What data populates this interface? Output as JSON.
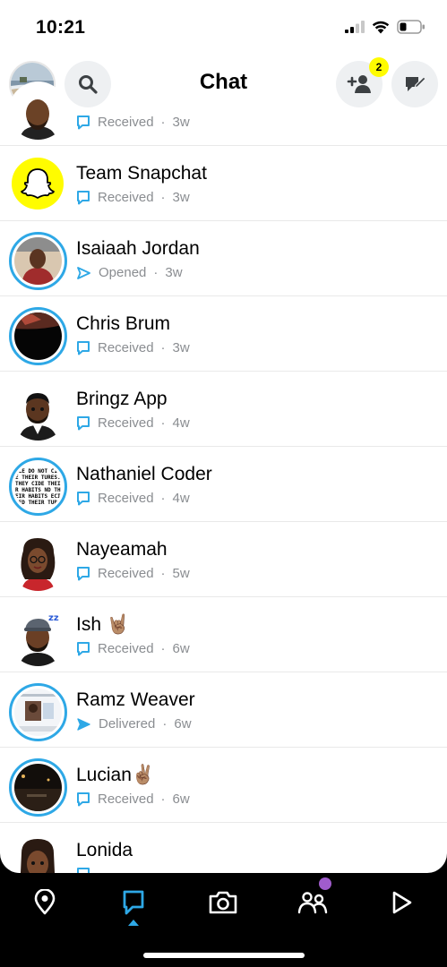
{
  "status_bar": {
    "time": "10:21"
  },
  "header": {
    "title": "Chat",
    "friend_requests_badge": "2"
  },
  "chats": [
    {
      "name": "",
      "status": "Received",
      "age": "3w",
      "status_kind": "received"
    },
    {
      "name": "Team Snapchat",
      "status": "Received",
      "age": "3w",
      "status_kind": "received"
    },
    {
      "name": "Isaiaah Jordan",
      "status": "Opened",
      "age": "3w",
      "status_kind": "opened"
    },
    {
      "name": "Chris Brum",
      "status": "Received",
      "age": "3w",
      "status_kind": "received"
    },
    {
      "name": "Bringz App",
      "status": "Received",
      "age": "4w",
      "status_kind": "received"
    },
    {
      "name": "Nathaniel Coder",
      "status": "Received",
      "age": "4w",
      "status_kind": "received"
    },
    {
      "name": "Nayeamah",
      "status": "Received",
      "age": "5w",
      "status_kind": "received"
    },
    {
      "name": "Ish 🤘🏽",
      "status": "Received",
      "age": "6w",
      "status_kind": "received"
    },
    {
      "name": "Ramz Weaver",
      "status": "Delivered",
      "age": "6w",
      "status_kind": "delivered"
    },
    {
      "name": "Lucian✌🏽",
      "status": "Received",
      "age": "6w",
      "status_kind": "received"
    },
    {
      "name": "Lonida",
      "status": "",
      "age": "",
      "status_kind": "received"
    }
  ],
  "story_thumbnail_text": {
    "nathaniel": "PLE DO NOT CIDE THEIR TURES. THEY CIDE THEIR HABITS ND THEIR HABITS ECIDED THEIR TURES."
  },
  "bottom_nav": {
    "items": [
      "map",
      "chat",
      "camera",
      "stories",
      "spotlight"
    ],
    "active": "chat"
  },
  "colors": {
    "snap_yellow": "#fffc00",
    "chat_blue": "#2ea8e6",
    "stories_purple": "#a05ccc",
    "subtext_gray": "#8a8d91"
  }
}
